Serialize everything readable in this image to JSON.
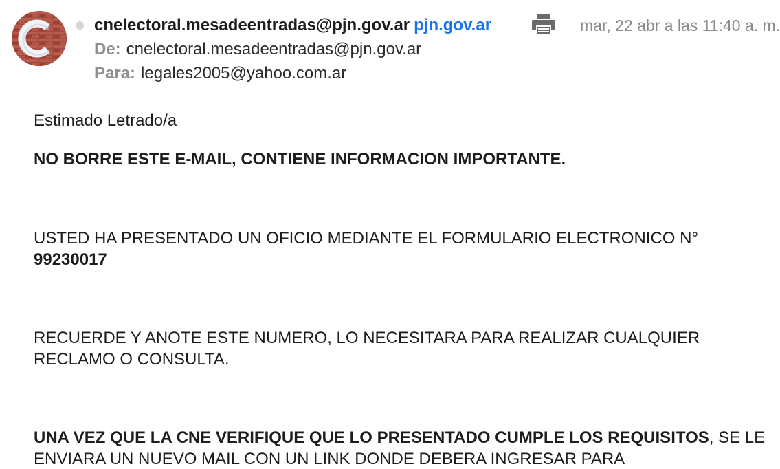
{
  "header": {
    "avatar_icon": "sender-logo-icon",
    "sender_name": "cnelectoral.mesadeentradas@pjn.gov.ar",
    "sender_domain": "pjn.gov.ar",
    "print_icon": "printer-icon",
    "date": "mar, 22 abr a las 11:40 a. m.",
    "from_label": "De:",
    "from_value": "cnelectoral.mesadeentradas@pjn.gov.ar",
    "to_label": "Para:",
    "to_value": "legales2005@yahoo.com.ar"
  },
  "body": {
    "greeting": "Estimado Letrado/a",
    "warning": "NO BORRE ESTE E-MAIL, CONTIENE INFORMACION IMPORTANTE.",
    "para1_text": "USTED HA PRESENTADO UN OFICIO MEDIANTE EL FORMULARIO ELECTRONICO N°",
    "para1_number": "99230017",
    "para2": "RECUERDE Y ANOTE ESTE NUMERO, LO NECESITARA PARA REALIZAR CUALQUIER RECLAMO O CONSULTA.",
    "para3_bold": "UNA VEZ QUE LA CNE VERIFIQUE QUE LO PRESENTADO CUMPLE LOS REQUISITOS",
    "para3_rest": ", SE LE ENVIARA UN NUEVO MAIL CON UN LINK DONDE DEBERA INGRESAR PARA"
  },
  "colors": {
    "link": "#1a73e8",
    "muted": "#8a8a8a",
    "text": "#1d1d1d"
  }
}
